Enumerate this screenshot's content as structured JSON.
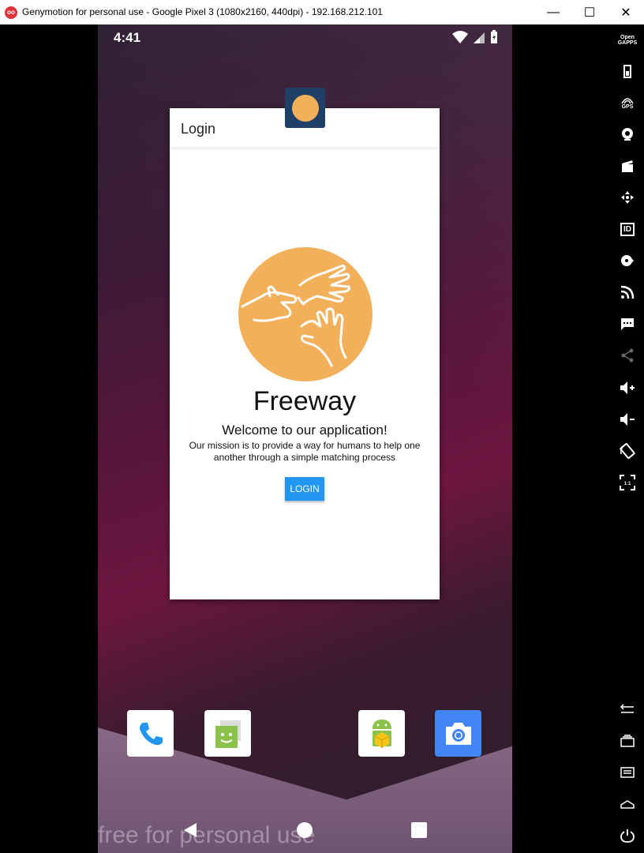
{
  "window": {
    "title": "Genymotion for personal use - Google Pixel 3 (1080x2160, 440dpi) - 192.168.212.101",
    "minimize": "—",
    "maximize": "☐",
    "close": "✕"
  },
  "status_bar": {
    "time": "4:41",
    "icons": [
      "wifi-icon",
      "signal-icon",
      "battery-icon"
    ]
  },
  "dialog": {
    "title": "Login",
    "brand": "Freeway",
    "welcome": "Welcome to our application!",
    "mission": "Our mission is to provide a way for humans to help one another through a simple matching process",
    "login_label": "LOGIN",
    "logo_color": "#f2b05a",
    "button_color": "#2196f3"
  },
  "dock": {
    "apps": [
      "phone-icon",
      "messages-icon",
      "apk-installer-icon",
      "camera-icon"
    ]
  },
  "navbar": {
    "buttons": [
      "back-icon",
      "home-icon",
      "recents-icon"
    ]
  },
  "watermark": "free for personal use",
  "toolbar": {
    "open_gapps": "Open GAPPS",
    "gps": "GPS",
    "id": "ID"
  }
}
